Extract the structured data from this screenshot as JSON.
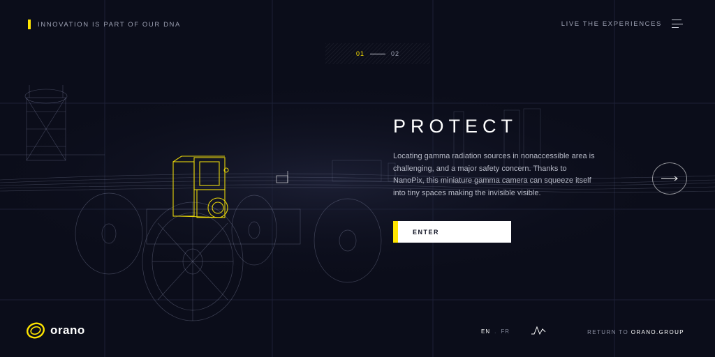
{
  "header": {
    "tagline": "INNOVATION IS PART OF OUR DNA",
    "live_link": "LIVE THE EXPERIENCES"
  },
  "pager": {
    "current": "01",
    "next": "02"
  },
  "hero": {
    "title": "PROTECT",
    "description": "Locating gamma radiation sources in nonaccessible area is challenging, and a major safety concern. Thanks to NanoPix, this miniature gamma camera can squeeze itself into tiny spaces making the invisible visible.",
    "cta_label": "ENTER"
  },
  "footer": {
    "logo_text": "orano",
    "lang_en": "EN",
    "lang_sep": ".",
    "lang_fr": "FR",
    "return_prefix": "RETURN TO ",
    "return_brand": "ORANO.GROUP"
  },
  "colors": {
    "background": "#0b0d1a",
    "accent": "#ffe500",
    "text": "#ffffff"
  },
  "icons": {
    "menu": "hamburger-icon",
    "next": "arrow-right-icon",
    "sound": "sound-wave-icon",
    "logo": "orano-ring-logo"
  }
}
